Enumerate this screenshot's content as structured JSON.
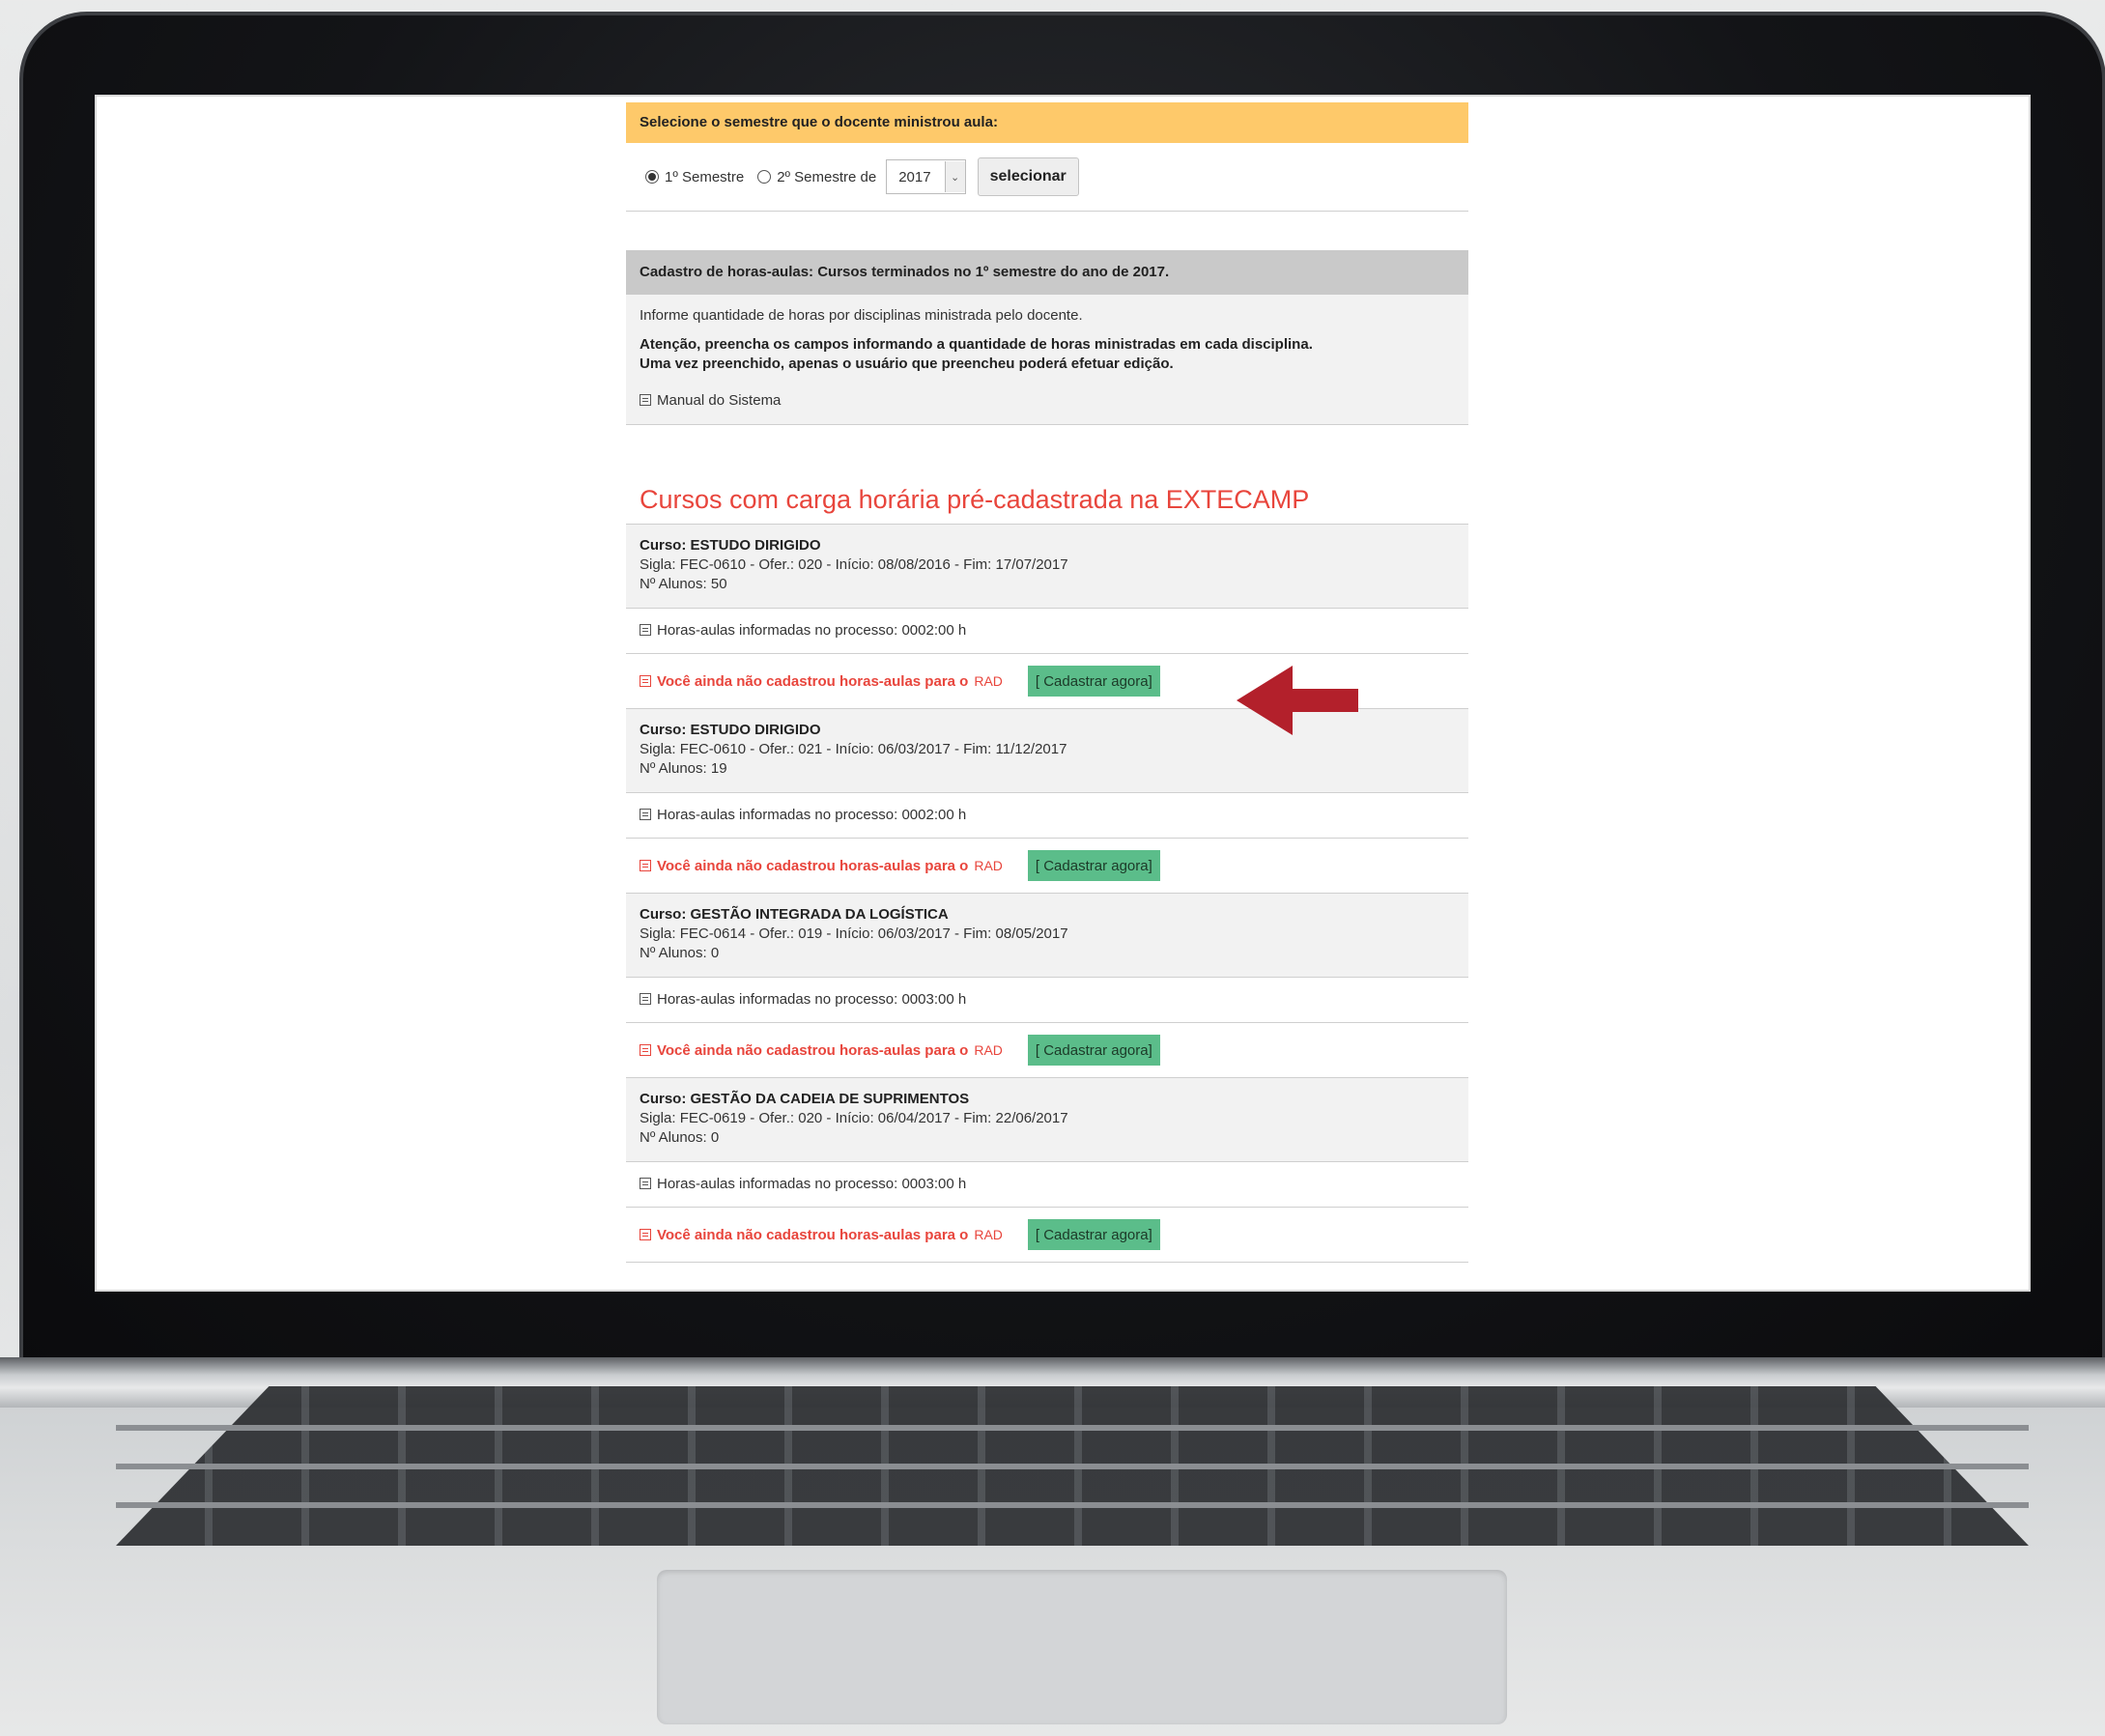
{
  "semester_box": {
    "header": "Selecione o semestre que o docente ministrou aula:",
    "first_label": "1º Semestre",
    "second_label": "2º Semestre de",
    "year": "2017",
    "select_button": "selecionar",
    "selected": "first"
  },
  "info_box": {
    "header": "Cadastro de horas-aulas: Cursos terminados no 1º semestre do ano de 2017.",
    "intro": "Informe quantidade de horas por disciplinas ministrada pelo docente.",
    "warning_line1": "Atenção, preencha os campos informando a quantidade de horas ministradas em cada disciplina.",
    "warning_line2": "Uma vez preenchido, apenas o usuário que preencheu poderá efetuar edição.",
    "manual_link": "Manual do Sistema"
  },
  "section_title": "Cursos com carga horária pré-cadastrada na EXTECAMP",
  "courses": [
    {
      "name": "Curso: ESTUDO DIRIGIDO",
      "details": "Sigla: FEC-0610 - Ofer.: 020 - Início: 08/08/2016 - Fim: 17/07/2017",
      "students": "Nº Alunos: 50",
      "hours": "Horas-aulas informadas no processo: 0002:00 h",
      "warning": "Você ainda não cadastrou horas-aulas para o",
      "rad": "RAD",
      "button": "[ Cadastrar agora]"
    },
    {
      "name": "Curso: ESTUDO DIRIGIDO",
      "details": "Sigla: FEC-0610 - Ofer.: 021 - Início: 06/03/2017 - Fim: 11/12/2017",
      "students": "Nº Alunos: 19",
      "hours": "Horas-aulas informadas no processo: 0002:00 h",
      "warning": "Você ainda não cadastrou horas-aulas para o",
      "rad": "RAD",
      "button": "[ Cadastrar agora]"
    },
    {
      "name": "Curso: GESTÃO INTEGRADA DA LOGÍSTICA",
      "details": "Sigla: FEC-0614 - Ofer.: 019 - Início: 06/03/2017 - Fim: 08/05/2017",
      "students": "Nº Alunos: 0",
      "hours": "Horas-aulas informadas no processo: 0003:00 h",
      "warning": "Você ainda não cadastrou horas-aulas para o",
      "rad": "RAD",
      "button": "[ Cadastrar agora]"
    },
    {
      "name": "Curso: GESTÃO DA CADEIA DE SUPRIMENTOS",
      "details": "Sigla: FEC-0619 - Ofer.: 020 - Início: 06/04/2017 - Fim: 22/06/2017",
      "students": "Nº Alunos: 0",
      "hours": "Horas-aulas informadas no processo: 0003:00 h",
      "warning": "Você ainda não cadastrou horas-aulas para o",
      "rad": "RAD",
      "button": "[ Cadastrar agora]"
    }
  ],
  "colors": {
    "header_yellow": "#fec96a",
    "header_gray": "#c9c9c9",
    "title_red": "#e8453c",
    "button_green": "#5bbd8a",
    "annotation_arrow": "#b3202b"
  }
}
